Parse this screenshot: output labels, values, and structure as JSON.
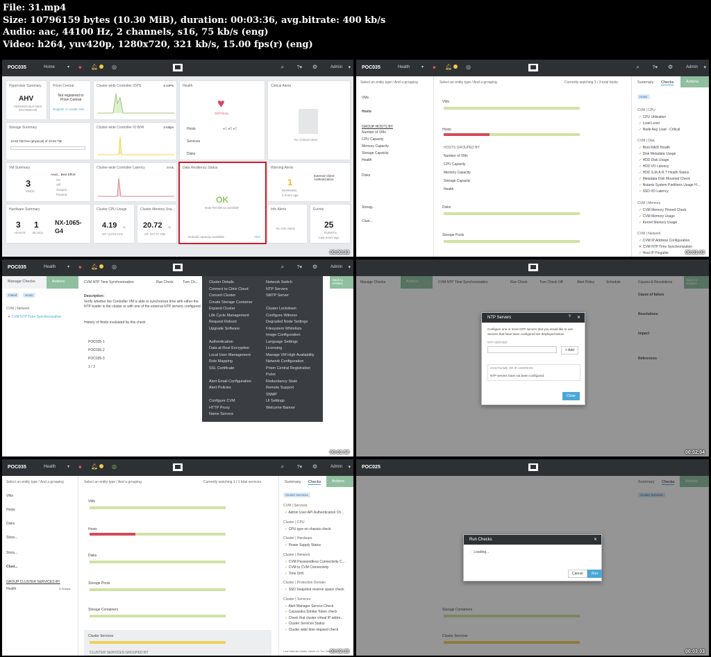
{
  "header": {
    "file": "File: 31.mp4",
    "size": "Size: 10796159 bytes (10.30 MiB), duration: 00:03:36, avg.bitrate: 400 kb/s",
    "audio": "Audio: aac, 44100 Hz, 2 channels, s16, 75 kb/s (eng)",
    "video": "Video: h264, yuv420p, 1280x720, 321 kb/s, 15.00 fps(r) (eng)"
  },
  "common": {
    "cluster": "POC035",
    "cluster2": "POC025",
    "admin": "Admin",
    "entity_prompt": "Select an entity type / And a grouping",
    "summary_tab": "Summary",
    "checks_tab": "Checks",
    "actions": "Actions"
  },
  "frame1": {
    "page": "Home",
    "timestamp": "00:00:33",
    "hypervisor_title": "Hypervisor Summary",
    "hypervisor_value": "AHV",
    "hypervisor_version": "VERSION NUTANIX 20170830.58",
    "prism_title": "Prism Central",
    "prism_text": "Not registered to Prism Central",
    "prism_link": "Register or create new",
    "iops_title": "Cluster-wide Controller IOPS",
    "iops_value": "0 IOPS",
    "iobw_title": "Cluster-wide Controller IO B/W",
    "iobw_value": "0 KBps",
    "latency_title": "Cluster-wide Controller Latency",
    "latency_value": "0 ms",
    "health_title": "Health",
    "health_status": "CRITICAL",
    "health_rows": [
      "Hosts",
      "Services",
      "Disks"
    ],
    "critical_title": "Critical Alerts",
    "critical_text": "No Critical Alerts",
    "storage_title": "Storage Summary",
    "storage_text": "10.52 TiB free (physical) of 10.94 TiB",
    "vm_title": "VM Summary",
    "vm_value": "3",
    "vm_label": "VM(S)",
    "vm_states": [
      "On",
      "Off",
      "Suspen...",
      "Paused"
    ],
    "vm_states_header": "Avail...  Best Effort",
    "resiliency_title": "Data Resiliency Status",
    "resiliency_value": "OK",
    "resiliency_text": "Data Resiliency possible",
    "resiliency_footer": "Rebuild capacity available",
    "resiliency_yes": "YES",
    "warning_title": "Warning Alerts",
    "warning_value": "1",
    "warning_label": "WARNING",
    "warning_time": "2 hours ago",
    "warning_text": "External Client Authentication",
    "hardware_title": "Hardware Summary",
    "hosts_value": "3",
    "hosts_label": "HOSTS",
    "block_value": "1",
    "block_label": "BLOCK",
    "model": "NX-1065-G4",
    "cpu_title": "Cluster CPU Usage",
    "cpu_value": "4.19",
    "cpu_unit": "%",
    "cpu_of": "OF 12478 GHz",
    "mem_title": "Cluster Memory Usa...",
    "mem_value": "20.72",
    "mem_unit": "%",
    "mem_of": "OF 377.27 GiB",
    "info_title": "Info Alerts",
    "info_text": "No Info Alerts",
    "events_title": "Events",
    "events_value": "25",
    "events_label": "EVENTS",
    "events_time": "Last event ago"
  },
  "frame2": {
    "page": "Health",
    "timestamp": "00:01:03",
    "watching": "Currently watching 3 / 3 total hosts.",
    "entities": [
      "VMs",
      "Hosts",
      "Disks",
      "Storag...",
      "Clust..."
    ],
    "group_label": "GROUP HOSTS BY",
    "group_items": [
      "Number of VMs",
      "CPU Capacity",
      "Memory Capacity",
      "Storage Capacity",
      "Health"
    ],
    "sections": [
      "VMs",
      "Hosts",
      "Disks",
      "Storage Pools"
    ],
    "hosts_grouped": "HOSTS GROUPED BY",
    "metrics": [
      "Number of VMs",
      "CPU Capacity",
      "Memory Capacity",
      "Storage Capacity",
      "Health"
    ],
    "filters": "Hosts",
    "check_groups": [
      {
        "name": "CVM | CPU",
        "items": [
          "CPU Utilization",
          "Load Level",
          "Node Avg Load - Critical"
        ]
      },
      {
        "name": "CVM | Disk",
        "items": [
          "Boot RAID Health",
          "Disk Metadata Usage",
          "HDD Disk Usage",
          "HDD I/O Latency",
          "HDD S.M.A.R.T Health Status",
          "Metadata Disk Mounted Check",
          "Nutanix System Partitions Usage H...",
          "SSD I/O Latency"
        ]
      },
      {
        "name": "CVM | Memory",
        "items": [
          "CVM Memory Pinned Check",
          "CVM Memory Usage",
          "Kernel Memory Usage"
        ]
      },
      {
        "name": "CVM | Network",
        "items": [
          "CVM IP Address Configuration",
          "CVM NTP Time Synchronization",
          "Host IP Pingable"
        ]
      }
    ]
  },
  "frame3": {
    "page": "Health",
    "timestamp": "00:01:58",
    "manage_checks": "Manage Checks",
    "check_name": "CVM NTP Time Synchronization",
    "run_check": "Run Check",
    "turn_check": "Turn Ch...",
    "back": "Back to Entities",
    "filter_failed": "Failed",
    "filter_hosts": "Hosts",
    "group": "CVM | Network",
    "description_label": "Description:",
    "description": "Verify whether the Controller VM is able to synchronize time with either the NTP leader in the cluster or with one of the external NTP servers configured",
    "history": "History of Hosts evaluated by this check",
    "hosts": [
      "POC035-1",
      "POC035-2",
      "POC035-3"
    ],
    "pager": "1 / 3",
    "menu_left": [
      "Cluster Details",
      "Connect to Citrix Cloud",
      "Convert Cluster",
      "Create Storage Container",
      "Expand Cluster",
      "Life Cycle Management",
      "Request Reboot",
      "Upgrade Software",
      "",
      "Authentication",
      "Data at Rest Encryption",
      "Local User Management",
      "Role Mapping",
      "SSL Certificate",
      "",
      "Alert Email Configuration",
      "Alert Policies",
      "",
      "Configure CVM",
      "HTTP Proxy",
      "Name Servers"
    ],
    "menu_right": [
      "Network Switch",
      "NTP Servers",
      "SMTP Server",
      "",
      "Cluster Lockdown",
      "Configure Witness",
      "Degraded Node Settings",
      "Filesystem Whitelists",
      "Image Configuration",
      "Language Settings",
      "Licensing",
      "Manage VM High Availability",
      "Network Configuration",
      "Prism Central Registration",
      "Pulse",
      "Redundancy State",
      "Remote Support",
      "SNMP",
      "UI Settings",
      "Welcome Banner"
    ]
  },
  "frame4": {
    "timestamp": "00:02:04",
    "modal_title": "NTP Servers",
    "modal_text": "Configure one or more NTP servers that you would like to use Servers that have been configured are displayed below.",
    "ntp_label": "NTP SERVER",
    "add": "Add",
    "list_header": "HOSTNAME OR IP ADDRESS",
    "list_empty": "NTP servers have not been configured.",
    "close": "Close",
    "manage_checks": "Manage Checks",
    "check_name": "CVM NTP Time Synchronization",
    "run_check": "Run Check",
    "turn_off": "Turn Check Off",
    "alert_policy": "Alert Policy",
    "schedule": "Schedule",
    "causes": "Causes & Resolutions",
    "back": "Back to Entities",
    "causes_items": [
      "Cause of failure",
      "Resolutions",
      "Impact",
      "References"
    ]
  },
  "frame5": {
    "page": "Health",
    "timestamp": "00:02:35",
    "watching": "Currently watching 1 / 1 total services.",
    "entities": [
      "VMs",
      "Hosts",
      "Disks",
      "Stora...",
      "Stora...",
      "Clust..."
    ],
    "group_label": "GROUP CLUSTER SERVICES BY",
    "group_item": "Health",
    "group_count": "3 Groups",
    "sections": [
      "VMs",
      "Hosts",
      "Disks",
      "Storage Pools",
      "Storage Containers",
      "Cluster Services"
    ],
    "services_grouped": "CLUSTER SERVICES GROUPED BY",
    "filter": "Cluster Services",
    "check_groups": [
      {
        "name": "CVM | Services",
        "items": [
          "Admin User API Authentication Ch..."
        ]
      },
      {
        "name": "Cluster | CPU",
        "items": [
          "CPU type on chassis check"
        ]
      },
      {
        "name": "Cluster | Hardware",
        "items": [
          "Power Supply Status"
        ]
      },
      {
        "name": "Cluster | Network",
        "items": [
          "CVM Passwordless Connectivity C...",
          "CVM to CVM Connectivity",
          "Time Drift"
        ]
      },
      {
        "name": "Cluster | Protection Domain",
        "items": [
          "SSD Snapshot reserve space check"
        ]
      },
      {
        "name": "Cluster | Services",
        "items": [
          "Alert Manager Service Check",
          "Cassandra Similar Token check",
          "Check that cluster virtual IP addre...",
          "Cluster Services Status",
          "Cluster wide time elapsed check"
        ]
      }
    ],
    "last_manual": "Last manual cluster check on Tue Nov 14..."
  },
  "frame6": {
    "timestamp": "00:03:03",
    "modal_title": "Run Checks",
    "loading": "Loading...",
    "cancel": "Cancel",
    "run": "Run"
  }
}
